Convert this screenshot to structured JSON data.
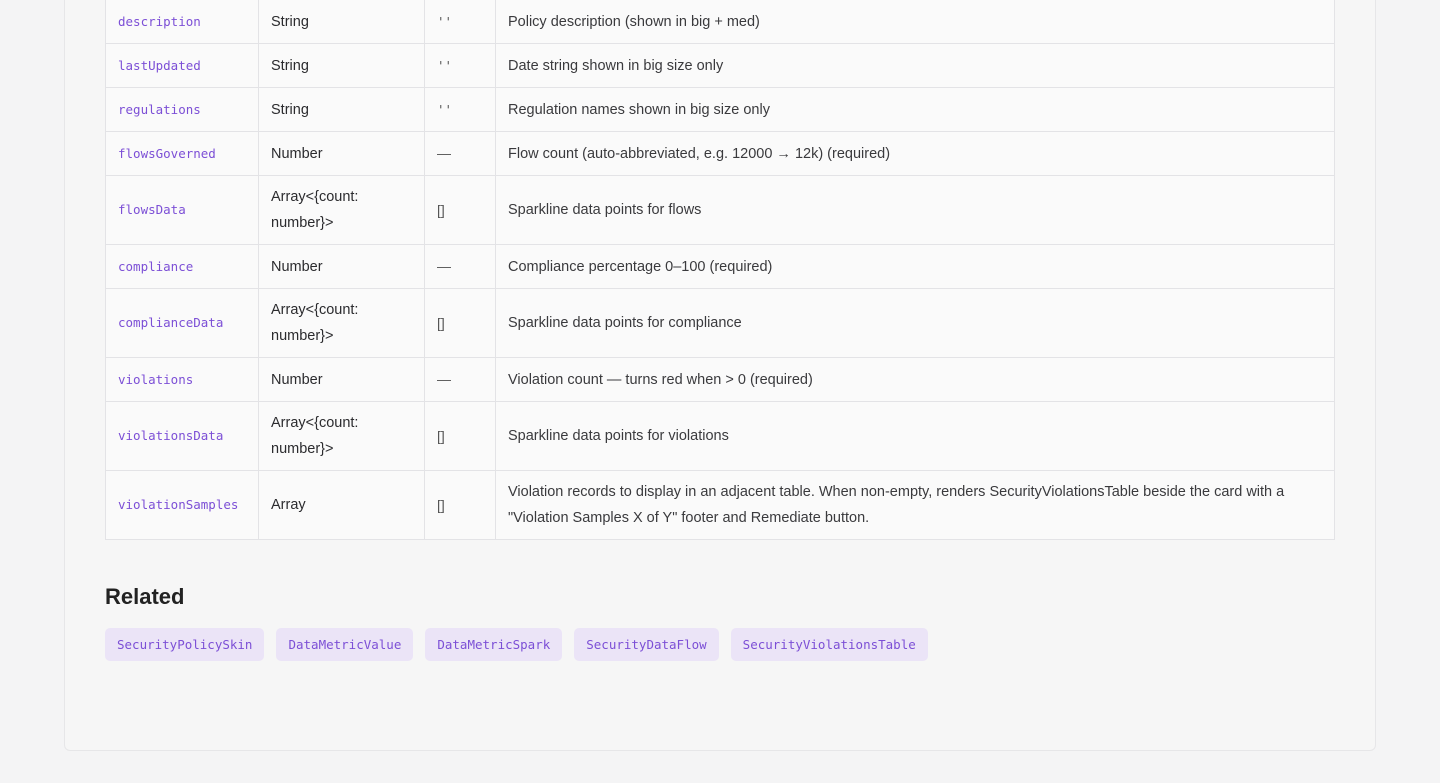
{
  "props_table": {
    "rows": [
      {
        "name": "description",
        "type": "String",
        "default": "''",
        "description": "Policy description (shown in big + med)"
      },
      {
        "name": "lastUpdated",
        "type": "String",
        "default": "''",
        "description": "Date string shown in big size only"
      },
      {
        "name": "regulations",
        "type": "String",
        "default": "''",
        "description": "Regulation names shown in big size only"
      },
      {
        "name": "flowsGoverned",
        "type": "Number",
        "default": "—",
        "description": "Flow count (auto-abbreviated, e.g. 12000 → 12k) (required)"
      },
      {
        "name": "flowsData",
        "type": "Array<{count: number}>",
        "default": "[]",
        "description": "Sparkline data points for flows"
      },
      {
        "name": "compliance",
        "type": "Number",
        "default": "—",
        "description": "Compliance percentage 0–100 (required)"
      },
      {
        "name": "complianceData",
        "type": "Array<{count: number}>",
        "default": "[]",
        "description": "Sparkline data points for compliance"
      },
      {
        "name": "violations",
        "type": "Number",
        "default": "—",
        "description": "Violation count — turns red when > 0 (required)"
      },
      {
        "name": "violationsData",
        "type": "Array<{count: number}>",
        "default": "[]",
        "description": "Sparkline data points for violations"
      },
      {
        "name": "violationSamples",
        "type": "Array",
        "default": "[]",
        "description": "Violation records to display in an adjacent table. When non-empty, renders SecurityViolationsTable beside the card with a \"Violation Samples X of Y\" footer and Remediate button."
      }
    ]
  },
  "related": {
    "title": "Related",
    "links": [
      "SecurityPolicySkin",
      "DataMetricValue",
      "DataMetricSpark",
      "SecurityDataFlow",
      "SecurityViolationsTable"
    ]
  }
}
